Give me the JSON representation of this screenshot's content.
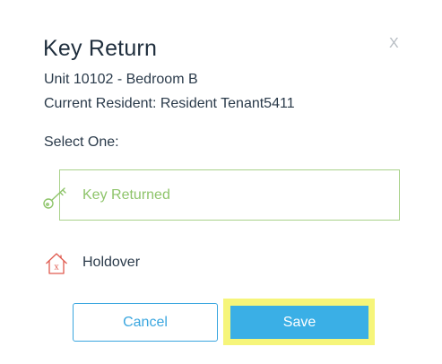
{
  "dialog": {
    "title": "Key Return",
    "close_label": "X",
    "unit": "Unit 10102 - Bedroom B",
    "resident": "Current Resident: Resident Tenant5411",
    "select_label": "Select One:"
  },
  "options": [
    {
      "label": "Key Returned",
      "icon": "key-icon",
      "color": "#8ec46a",
      "selected": true
    },
    {
      "label": "Holdover",
      "icon": "house-x-icon",
      "color": "#e05a4f",
      "selected": false
    }
  ],
  "buttons": {
    "cancel_label": "Cancel",
    "save_label": "Save"
  },
  "colors": {
    "accent_blue": "#3aafe6",
    "highlight_yellow": "#f6f57a",
    "key_green": "#8ec46a",
    "holdover_red": "#e05a4f"
  }
}
